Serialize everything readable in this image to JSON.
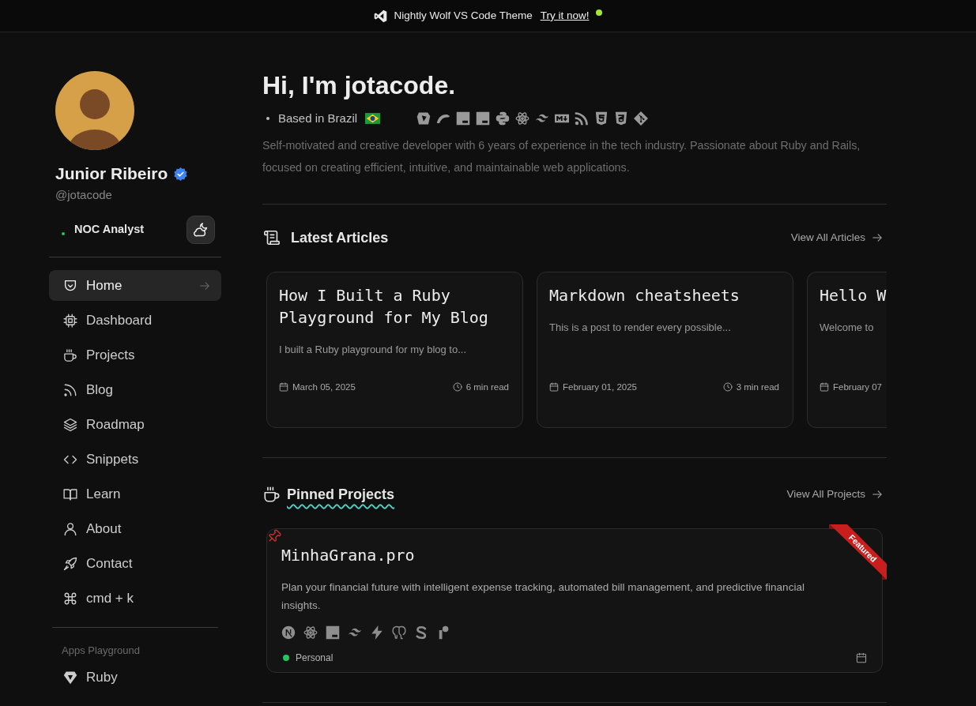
{
  "banner": {
    "title": "Nightly Wolf VS Code Theme",
    "link": "Try it now!"
  },
  "sidebar": {
    "name": "Junior Ribeiro",
    "handle": "@jotacode",
    "status": "NOC Analyst",
    "nav": [
      {
        "label": "Home",
        "selected": true
      },
      {
        "label": "Dashboard",
        "selected": false
      },
      {
        "label": "Projects",
        "selected": false
      },
      {
        "label": "Blog",
        "selected": false
      },
      {
        "label": "Roadmap",
        "selected": false
      },
      {
        "label": "Snippets",
        "selected": false
      },
      {
        "label": "Learn",
        "selected": false
      },
      {
        "label": "About",
        "selected": false
      },
      {
        "label": "Contact",
        "selected": false
      },
      {
        "label": "cmd + k",
        "selected": false
      }
    ],
    "apps_heading": "Apps Playground",
    "apps": [
      {
        "label": "Ruby",
        "selected": false
      }
    ]
  },
  "hero": {
    "title": "Hi, I'm jotacode.",
    "location": "Based in Brazil",
    "bio": "Self-motivated and creative developer with 6 years of experience in the tech industry. Passionate about Ruby and Rails, focused on creating efficient, intuitive, and maintainable web applications."
  },
  "articles": {
    "heading": "Latest Articles",
    "view_all": "View All Articles",
    "items": [
      {
        "title": "How I Built a Ruby Playground for My Blog",
        "excerpt": "I built a Ruby playground for my blog to...",
        "date": "March 05, 2025",
        "read_time": "6 min read"
      },
      {
        "title": "Markdown cheatsheets",
        "excerpt": "This is a post to render every possible...",
        "date": "February 01, 2025",
        "read_time": "3 min read"
      },
      {
        "title": "Hello W",
        "excerpt": "Welcome to",
        "date": "February 07"
      }
    ]
  },
  "projects": {
    "heading": "Pinned Projects",
    "view_all": "View All Projects",
    "items": [
      {
        "title": "MinhaGrana.pro",
        "description": "Plan your financial future with intelligent expense tracking, automated bill management, and predictive financial insights.",
        "pinned": true,
        "ribbon": "Featured",
        "category": "Personal"
      }
    ]
  }
}
